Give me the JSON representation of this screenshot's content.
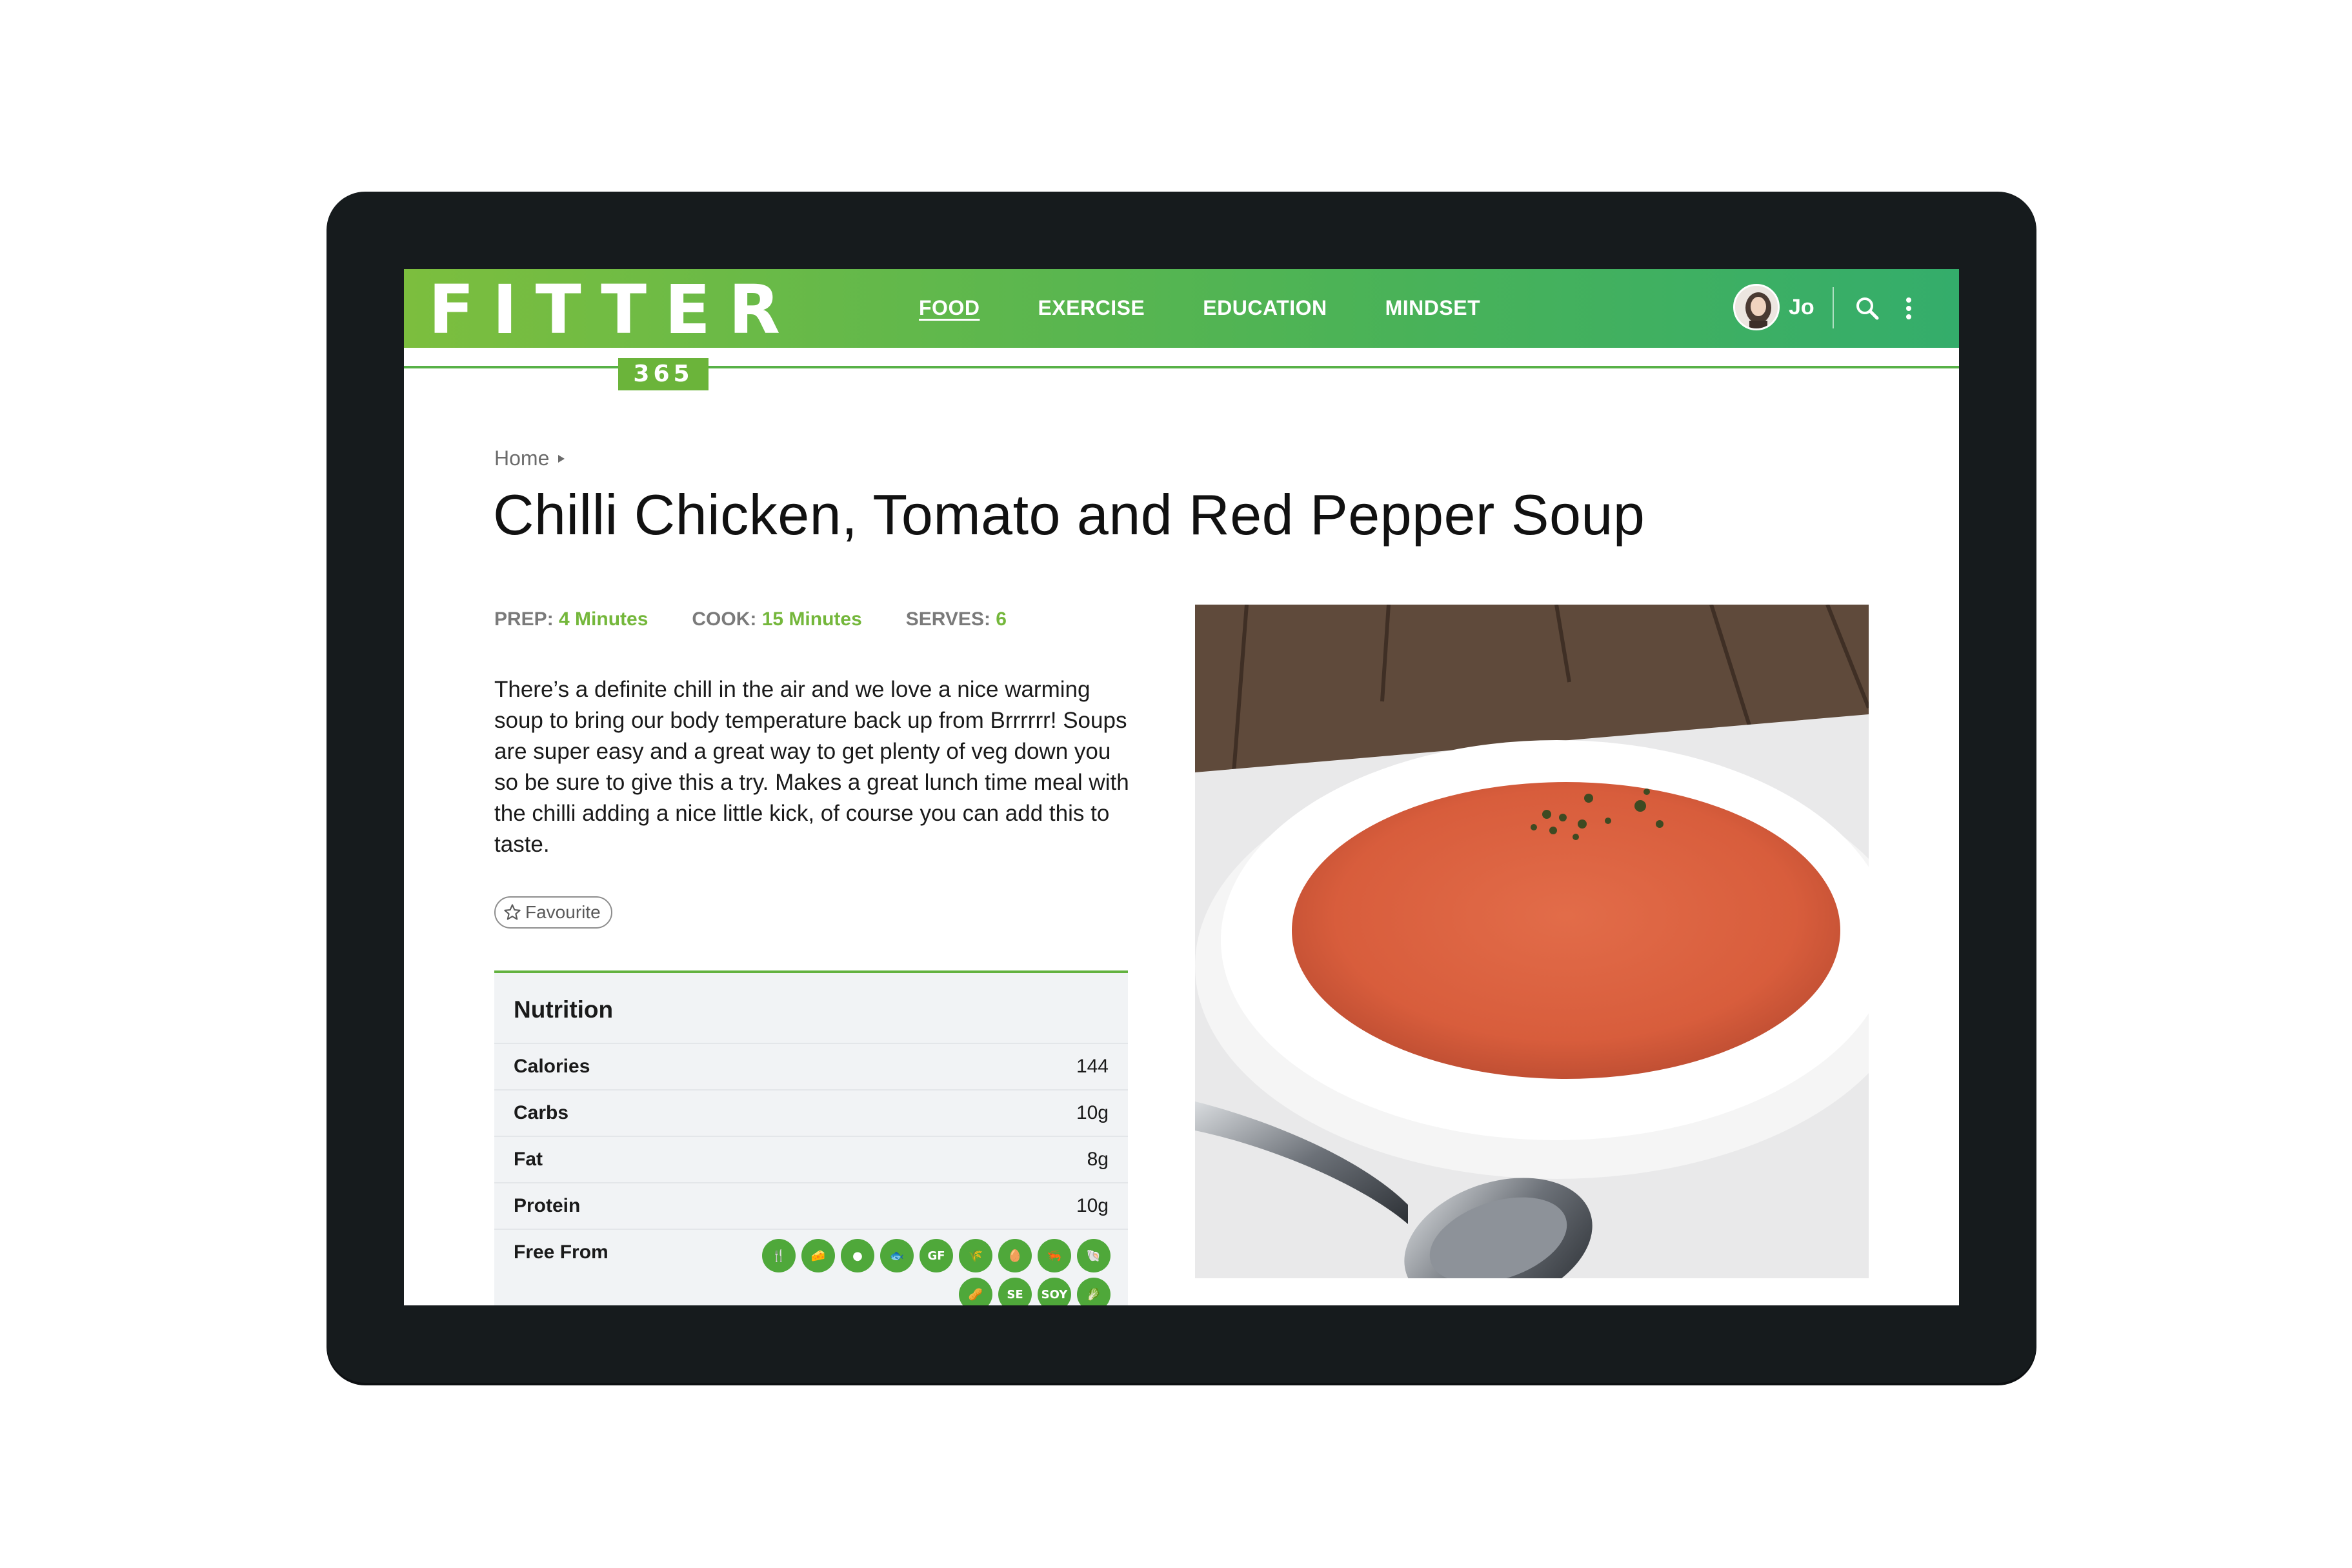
{
  "brand": {
    "logo": "FITTER",
    "logo_sub": "365",
    "primary": "#5ab84a",
    "accent": "#74b73b"
  },
  "nav": {
    "items": [
      {
        "label": "FOOD",
        "active": true
      },
      {
        "label": "EXERCISE",
        "active": false
      },
      {
        "label": "EDUCATION",
        "active": false
      },
      {
        "label": "MINDSET",
        "active": false
      }
    ]
  },
  "user": {
    "name": "Jo"
  },
  "icons": {
    "search": "search-icon",
    "more": "more-vertical-icon",
    "favourite": "star-outline-icon",
    "breadcrumb_arrow": "caret-right-icon"
  },
  "breadcrumb": {
    "home": "Home"
  },
  "recipe": {
    "title": "Chilli Chicken, Tomato and Red Pepper Soup",
    "prep_label": "PREP:",
    "prep_value": "4 Minutes",
    "cook_label": "COOK:",
    "cook_value": "15 Minutes",
    "serves_label": "SERVES:",
    "serves_value": "6",
    "description": "There’s a definite chill in the air and we love a nice warming soup to bring our body temperature back up from Brrrrrr! Soups are super easy and a great way to get plenty of veg down you so be sure to give this a try. Makes a great lunch time meal with the chilli adding a nice little kick, of course you can add this to taste.",
    "favourite_label": "Favourite"
  },
  "nutrition": {
    "title": "Nutrition",
    "rows": [
      {
        "label": "Calories",
        "value": "144"
      },
      {
        "label": "Carbs",
        "value": "10g"
      },
      {
        "label": "Fat",
        "value": "8g"
      },
      {
        "label": "Protein",
        "value": "10g"
      }
    ],
    "free_from_label": "Free From",
    "free_from_icons": [
      {
        "name": "meat-free-icon",
        "glyph": "🍴"
      },
      {
        "name": "dairy-free-icon",
        "glyph": "🧀"
      },
      {
        "name": "nut-free-icon",
        "glyph": "●"
      },
      {
        "name": "fish-free-icon",
        "glyph": "🐟"
      },
      {
        "name": "gluten-free-icon",
        "glyph": "GF"
      },
      {
        "name": "wheat-free-icon",
        "glyph": "🌾"
      },
      {
        "name": "egg-free-icon",
        "glyph": "🥚"
      },
      {
        "name": "crustacean-free-icon",
        "glyph": "🦐"
      },
      {
        "name": "mollusc-free-icon",
        "glyph": "🐚"
      },
      {
        "name": "peanut-free-icon",
        "glyph": "🥜"
      },
      {
        "name": "sesame-free-icon",
        "glyph": "SE"
      },
      {
        "name": "soy-free-icon",
        "glyph": "SOY"
      },
      {
        "name": "celery-free-icon",
        "glyph": "🥬"
      }
    ]
  }
}
